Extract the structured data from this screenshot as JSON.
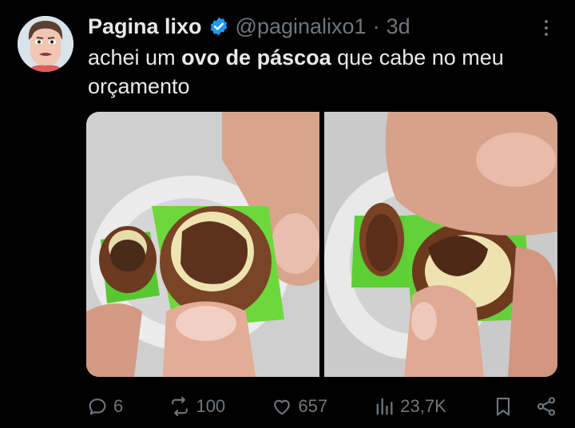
{
  "tweet": {
    "author_name": "Pagina lixo",
    "handle": "@paginalixo1",
    "separator": "·",
    "time": "3d",
    "text_before": "achei um ",
    "text_bold": "ovo de páscoa",
    "text_after": " que cabe no meu orçamento"
  },
  "actions": {
    "replies": "6",
    "reposts": "100",
    "likes": "657",
    "views": "23,7K"
  },
  "icons": {
    "verified": "verified-badge-icon",
    "more": "more-options-icon",
    "reply": "reply-icon",
    "repost": "repost-icon",
    "like": "heart-icon",
    "views": "views-icon",
    "bookmark": "bookmark-icon",
    "share": "share-icon"
  },
  "colors": {
    "background": "#000000",
    "text": "#e7e9ea",
    "muted": "#71767b",
    "verified": "#1d9bf0"
  }
}
